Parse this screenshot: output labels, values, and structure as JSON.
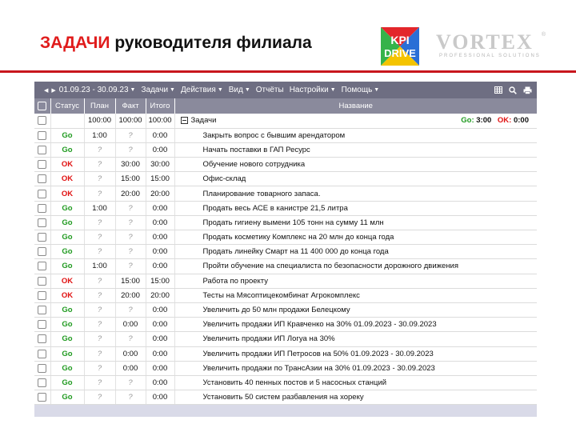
{
  "slide": {
    "title_accent": "ЗАДАЧИ",
    "title_rest": "руководителя филиала",
    "kpi_logo_line1": "KPI",
    "kpi_logo_line2": "DRIVE",
    "vortex_word": "VORTEX",
    "vortex_sub": "PROFESSIONAL SOLUTIONS",
    "vortex_reg": "®"
  },
  "toolbar": {
    "date_range": "01.09.23 - 30.09.23",
    "menus": [
      "Задачи",
      "Действия",
      "Вид",
      "Отчёты",
      "Настройки",
      "Помощь"
    ],
    "menus_with_caret": [
      true,
      true,
      true,
      false,
      true,
      true
    ],
    "tool_icons": [
      "grid-icon",
      "search-icon",
      "print-icon"
    ]
  },
  "table": {
    "headers": {
      "status": "Статус",
      "plan": "План",
      "fact": "Факт",
      "total": "Итого",
      "name": "Название"
    },
    "total_row": {
      "plan": "100:00",
      "fact": "100:00",
      "total": "100:00",
      "name": "Задачи",
      "go_label": "Go:",
      "go_value": "3:00",
      "ok_label": "OK:",
      "ok_value": "0:00"
    },
    "rows": [
      {
        "status": "Go",
        "plan": "1:00",
        "fact": "?",
        "total": "0:00",
        "name": "Закрыть вопрос с бывшим арендатором"
      },
      {
        "status": "Go",
        "plan": "?",
        "fact": "?",
        "total": "0:00",
        "name": "Начать поставки в ГАП Ресурс"
      },
      {
        "status": "OK",
        "plan": "?",
        "fact": "30:00",
        "total": "30:00",
        "name": "Обучение нового сотрудника"
      },
      {
        "status": "OK",
        "plan": "?",
        "fact": "15:00",
        "total": "15:00",
        "name": "Офис-склад"
      },
      {
        "status": "OK",
        "plan": "?",
        "fact": "20:00",
        "total": "20:00",
        "name": "Планирование товарного запаса."
      },
      {
        "status": "Go",
        "plan": "1:00",
        "fact": "?",
        "total": "0:00",
        "name": "Продать весь АСЕ в канистре 21,5 литра"
      },
      {
        "status": "Go",
        "plan": "?",
        "fact": "?",
        "total": "0:00",
        "name": "Продать гигиену вымени 105 тонн на сумму 11 млн"
      },
      {
        "status": "Go",
        "plan": "?",
        "fact": "?",
        "total": "0:00",
        "name": "Продать косметику Комплекс на 20 млн до конца года"
      },
      {
        "status": "Go",
        "plan": "?",
        "fact": "?",
        "total": "0:00",
        "name": "Продать линейку Смарт на 11 400 000 до конца года"
      },
      {
        "status": "Go",
        "plan": "1:00",
        "fact": "?",
        "total": "0:00",
        "name": "Пройти обучение на специалиста по безопасности дорожного движения"
      },
      {
        "status": "OK",
        "plan": "?",
        "fact": "15:00",
        "total": "15:00",
        "name": "Работа по проекту"
      },
      {
        "status": "OK",
        "plan": "?",
        "fact": "20:00",
        "total": "20:00",
        "name": "Тесты на Мясоптицекомбинат Агрокомплекс"
      },
      {
        "status": "Go",
        "plan": "?",
        "fact": "?",
        "total": "0:00",
        "name": "Увеличить до 50 млн продажи Белецкому"
      },
      {
        "status": "Go",
        "plan": "?",
        "fact": "0:00",
        "total": "0:00",
        "name": "Увеличить продажи ИП Кравченко на 30% 01.09.2023 - 30.09.2023"
      },
      {
        "status": "Go",
        "plan": "?",
        "fact": "?",
        "total": "0:00",
        "name": "Увеличить продажи ИП Логуа на 30%"
      },
      {
        "status": "Go",
        "plan": "?",
        "fact": "0:00",
        "total": "0:00",
        "name": "Увеличить продажи ИП Петросов на 50% 01.09.2023 - 30.09.2023"
      },
      {
        "status": "Go",
        "plan": "?",
        "fact": "0:00",
        "total": "0:00",
        "name": "Увеличить продажи по ТрансАзии на 30% 01.09.2023 - 30.09.2023"
      },
      {
        "status": "Go",
        "plan": "?",
        "fact": "?",
        "total": "0:00",
        "name": "Установить 40 пенных постов и 5 насосных станций"
      },
      {
        "status": "Go",
        "plan": "?",
        "fact": "?",
        "total": "0:00",
        "name": "Установить 50 систем разбавления на хорeку"
      }
    ]
  },
  "colors": {
    "go": "#1f9a1f",
    "ok": "#e01010",
    "toolbar": "#6e6e82",
    "header": "#8a8a9c",
    "title_accent": "#e01b1b"
  }
}
